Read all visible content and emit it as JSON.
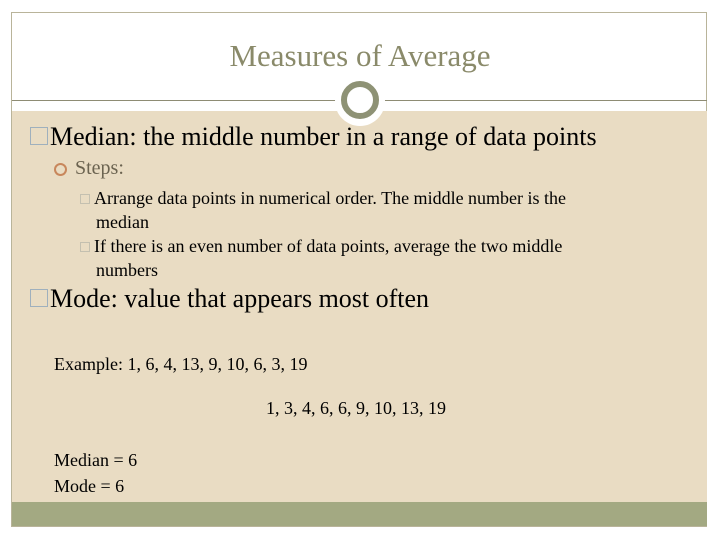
{
  "title": "Measures of Average",
  "bullets": {
    "median": "Median: the middle number in a range of data points",
    "steps_label": "Steps:",
    "step1_a": "Arrange data points in numerical order.  The middle number is the",
    "step1_b": "median",
    "step2_a": "If there is an even number of data points, average the two middle",
    "step2_b": "numbers",
    "mode": "Mode: value that appears most often"
  },
  "example": {
    "data": "Example: 1, 6, 4, 13, 9, 10, 6, 3, 19",
    "sorted": "1, 3, 4, 6, 6, 9, 10, 13, 19",
    "median": "Median = 6",
    "mode": "Mode = 6"
  },
  "colors": {
    "background": "#e9dcc3",
    "band": "#a3a982",
    "title": "#8a8a6a",
    "accent": "#8e9275"
  }
}
